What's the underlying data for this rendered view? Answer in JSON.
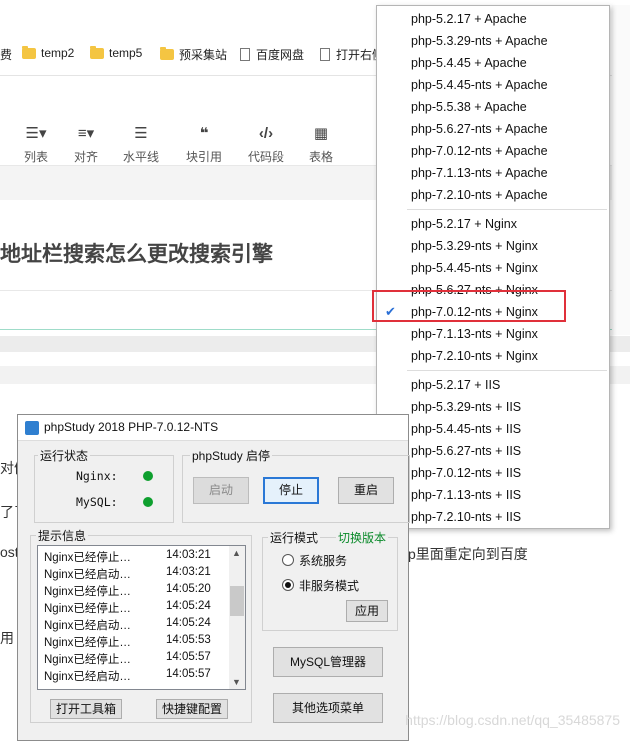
{
  "bookmarks": [
    {
      "label": "费",
      "type": "text"
    },
    {
      "label": "temp2",
      "type": "folder"
    },
    {
      "label": "temp5",
      "type": "folder"
    },
    {
      "label": "预采集站",
      "type": "folder"
    },
    {
      "label": "百度网盘",
      "type": "page"
    },
    {
      "label": "打开右侧",
      "type": "page"
    }
  ],
  "toolbar": [
    {
      "label": "列表",
      "icon": "list-icon"
    },
    {
      "label": "对齐",
      "icon": "align-icon"
    },
    {
      "label": "水平线",
      "icon": "hr-icon"
    },
    {
      "label": "块引用",
      "icon": "quote-icon"
    },
    {
      "label": "代码段",
      "icon": "code-icon"
    },
    {
      "label": "表格",
      "icon": "table-icon"
    }
  ],
  "article_title": "地址栏搜索怎么更改搜索引擎",
  "bg_text": {
    "line1": "对候",
    "line2": "了了",
    "line3": "ost",
    "line4": "p里面重定向到百度",
    "line5": "用"
  },
  "menu": {
    "apache": [
      "php-5.2.17 + Apache",
      "php-5.3.29-nts + Apache",
      "php-5.4.45 + Apache",
      "php-5.4.45-nts + Apache",
      "php-5.5.38 + Apache",
      "php-5.6.27-nts + Apache",
      "php-7.0.12-nts + Apache",
      "php-7.1.13-nts + Apache",
      "php-7.2.10-nts + Apache"
    ],
    "nginx": [
      "php-5.2.17 + Nginx",
      "php-5.3.29-nts + Nginx",
      "php-5.4.45-nts + Nginx",
      "php-5.6.27-nts + Nginx",
      "php-7.0.12-nts + Nginx",
      "php-7.1.13-nts + Nginx",
      "php-7.2.10-nts + Nginx"
    ],
    "iis": [
      "php-5.2.17 + IIS",
      "php-5.3.29-nts + IIS",
      "php-5.4.45-nts + IIS",
      "php-5.6.27-nts + IIS",
      "php-7.0.12-nts + IIS",
      "php-7.1.13-nts + IIS",
      "php-7.2.10-nts + IIS"
    ],
    "selected": "php-7.0.12-nts + Nginx"
  },
  "window": {
    "title": "phpStudy 2018    PHP-7.0.12-NTS",
    "status_group": "运行状态",
    "services": [
      {
        "name": "Nginx:",
        "status": "running"
      },
      {
        "name": "MySQL:",
        "status": "running"
      }
    ],
    "control_group": "phpStudy 启停",
    "btn_start": "启动",
    "btn_stop": "停止",
    "btn_restart": "重启",
    "log_group": "提示信息",
    "log": [
      {
        "msg": "Nginx已经停止…",
        "time": "14:03:21"
      },
      {
        "msg": "Nginx已经启动…",
        "time": "14:03:21"
      },
      {
        "msg": "Nginx已经停止…",
        "time": "14:05:20"
      },
      {
        "msg": "Nginx已经停止…",
        "time": "14:05:24"
      },
      {
        "msg": "Nginx已经启动…",
        "time": "14:05:24"
      },
      {
        "msg": "Nginx已经停止…",
        "time": "14:05:53"
      },
      {
        "msg": "Nginx已经停止…",
        "time": "14:05:57"
      },
      {
        "msg": "Nginx已经启动…",
        "time": "14:05:57"
      }
    ],
    "mode_group": "运行模式",
    "switch_version": "切换版本",
    "mode_system": "系统服务",
    "mode_nonservice": "非服务模式",
    "mode_selected": "非服务模式",
    "btn_apply": "应用",
    "btn_mysql": "MySQL管理器",
    "btn_tools": "打开工具箱",
    "btn_hotkeys": "快捷键配置",
    "btn_other": "其他选项菜单"
  },
  "watermark": "https://blog.csdn.net/qq_35485875",
  "colors": {
    "check": "#2a6fd6",
    "highlight_box": "#e0303a",
    "running": "#0e9f2e",
    "switch_version": "#0a8a2a"
  }
}
